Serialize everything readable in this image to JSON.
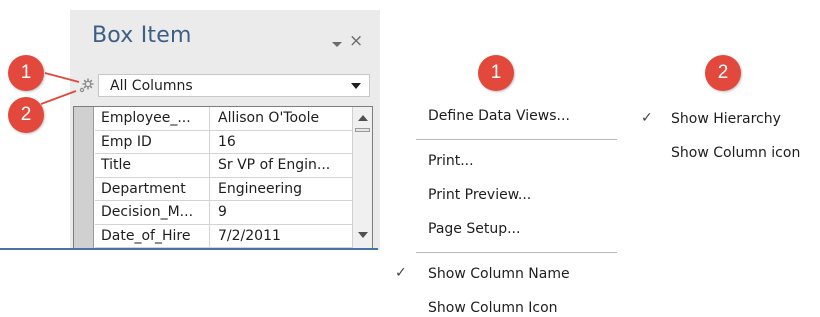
{
  "panel": {
    "title": "Box Item",
    "view_select": {
      "value": "All Columns"
    },
    "rows": [
      {
        "field": "Employee_...",
        "value": "Allison O'Toole"
      },
      {
        "field": "Emp ID",
        "value": "16"
      },
      {
        "field": "Title",
        "value": "Sr VP of Engin..."
      },
      {
        "field": "Department",
        "value": "Engineering"
      },
      {
        "field": "Decision_M...",
        "value": "9"
      },
      {
        "field": "Date_of_Hire",
        "value": "7/2/2011"
      }
    ]
  },
  "callouts": {
    "one": "1",
    "two": "2",
    "menu1_marker": "1",
    "menu2_marker": "2"
  },
  "menu1": {
    "define_views": "Define Data Views...",
    "print": "Print...",
    "print_preview": "Print Preview...",
    "page_setup": "Page Setup...",
    "show_column_name": "Show Column Name",
    "show_column_icon": "Show Column Icon",
    "check_mark": "✓"
  },
  "menu2": {
    "show_hierarchy": "Show Hierarchy",
    "show_column_icon": "Show Column icon",
    "check_mark": "✓"
  },
  "colors": {
    "title_blue": "#3d5f86",
    "callout_red": "#e2483b",
    "accent_line": "#4672a8"
  }
}
